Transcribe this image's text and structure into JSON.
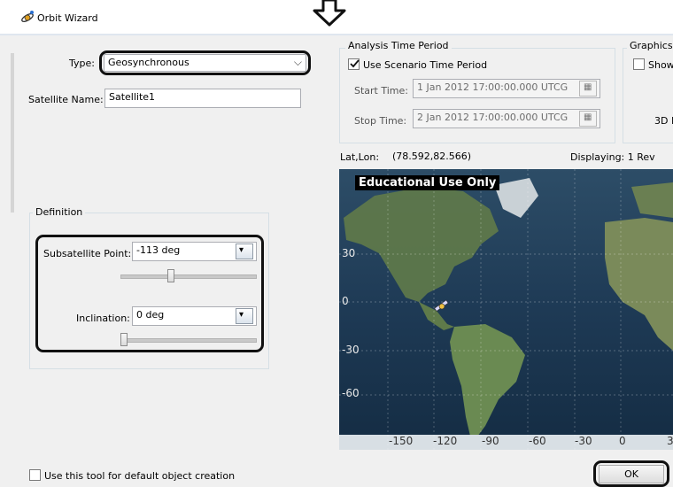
{
  "window": {
    "title": "Orbit Wizard"
  },
  "type_field": {
    "label": "Type:",
    "value": "Geosynchronous"
  },
  "satellite_name": {
    "label": "Satellite Name:",
    "value": "Satellite1"
  },
  "definition": {
    "group_label": "Definition",
    "subsatellite": {
      "label": "Subsatellite Point:",
      "value": "-113 deg",
      "slider_level": 0.37
    },
    "inclination": {
      "label": "Inclination:",
      "value": "0 deg",
      "slider_level": 0.0
    }
  },
  "analysis": {
    "group_label": "Analysis Time Period",
    "use_scenario_label": "Use Scenario Time Period",
    "use_scenario_checked": true,
    "start_label": "Start Time:",
    "start_value": "1 Jan 2012 17:00:00.000 UTCG",
    "stop_label": "Stop Time:",
    "stop_value": "2 Jan 2012 17:00:00.000 UTCG"
  },
  "graphics": {
    "group_label": "Graphics",
    "show_label": "Show",
    "three_d_label": "3D I"
  },
  "map": {
    "latlon_label": "Lat,Lon:",
    "latlon_value": "(78.592,82.566)",
    "displaying": "Displaying: 1 Rev",
    "watermark": "Educational Use Only",
    "lat_labels": [
      "30",
      "0",
      "-30",
      "-60"
    ],
    "lon_labels": [
      "-150",
      "-120",
      "-90",
      "-60",
      "-30",
      "0",
      "3"
    ]
  },
  "default_creation_label": "Use this tool for default object creation",
  "ok_label": "OK",
  "colors": {
    "ocean": "#1e3a55",
    "land": "#5f7a4a",
    "callout": "#111111"
  },
  "icons": [
    "orbit-wizard-icon",
    "down-arrow-icon",
    "chevron-down-icon",
    "spin-icon",
    "calendar-icon",
    "satellite-icon"
  ]
}
